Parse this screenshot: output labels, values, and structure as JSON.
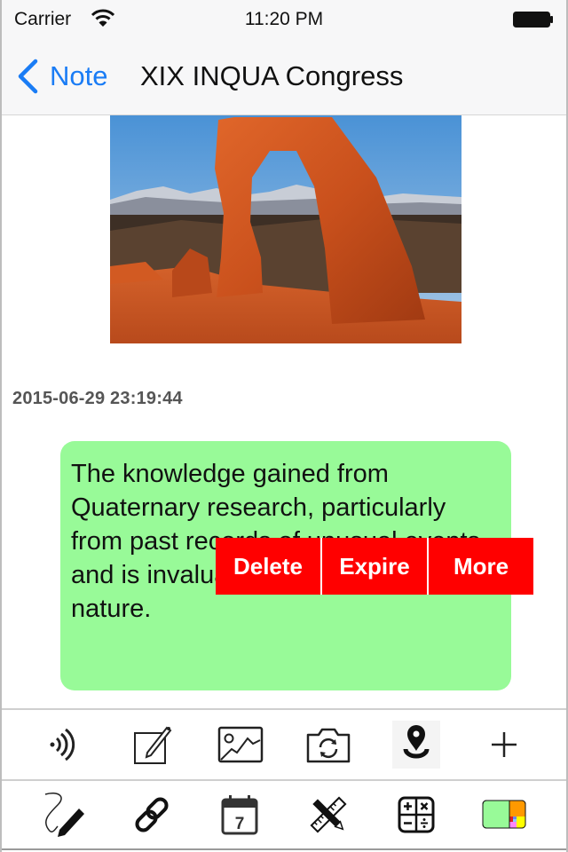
{
  "status_bar": {
    "carrier": "Carrier",
    "time": "11:20 PM",
    "wifi_icon": "wifi-icon",
    "battery_icon": "battery-full-icon"
  },
  "nav_bar": {
    "back_label": "Note",
    "title": "XIX INQUA Congress"
  },
  "note": {
    "image_description": "Delicate Arch, red sandstone arch with snowy mountains",
    "timestamp": "2015-06-29 23:19:44",
    "text": "The knowledge gained from Quaternary research, particularly from past records of unusual events and is invaluable for understanding nature.",
    "bubble_color": "#98fa98"
  },
  "context_menu": {
    "color": "#ff0000",
    "items": [
      {
        "label": "Delete"
      },
      {
        "label": "Expire"
      },
      {
        "label": "More"
      }
    ]
  },
  "toolbar_top": {
    "items": [
      {
        "icon": "audio-waves-icon",
        "label": "Audio"
      },
      {
        "icon": "edit-note-icon",
        "label": "Edit"
      },
      {
        "icon": "image-icon",
        "label": "Image"
      },
      {
        "icon": "camera-switch-icon",
        "label": "Camera"
      },
      {
        "icon": "location-pin-icon",
        "label": "Location"
      },
      {
        "icon": "plus-icon",
        "label": "Add"
      }
    ]
  },
  "toolbar_bottom": {
    "items": [
      {
        "icon": "handwriting-pen-icon",
        "label": "Draw"
      },
      {
        "icon": "link-icon",
        "label": "Link"
      },
      {
        "icon": "calendar-icon",
        "label": "Calendar",
        "day": "7"
      },
      {
        "icon": "ruler-pencil-icon",
        "label": "Tools"
      },
      {
        "icon": "calculator-icon",
        "label": "Calculator"
      },
      {
        "icon": "color-palette-icon",
        "label": "Color"
      }
    ]
  }
}
